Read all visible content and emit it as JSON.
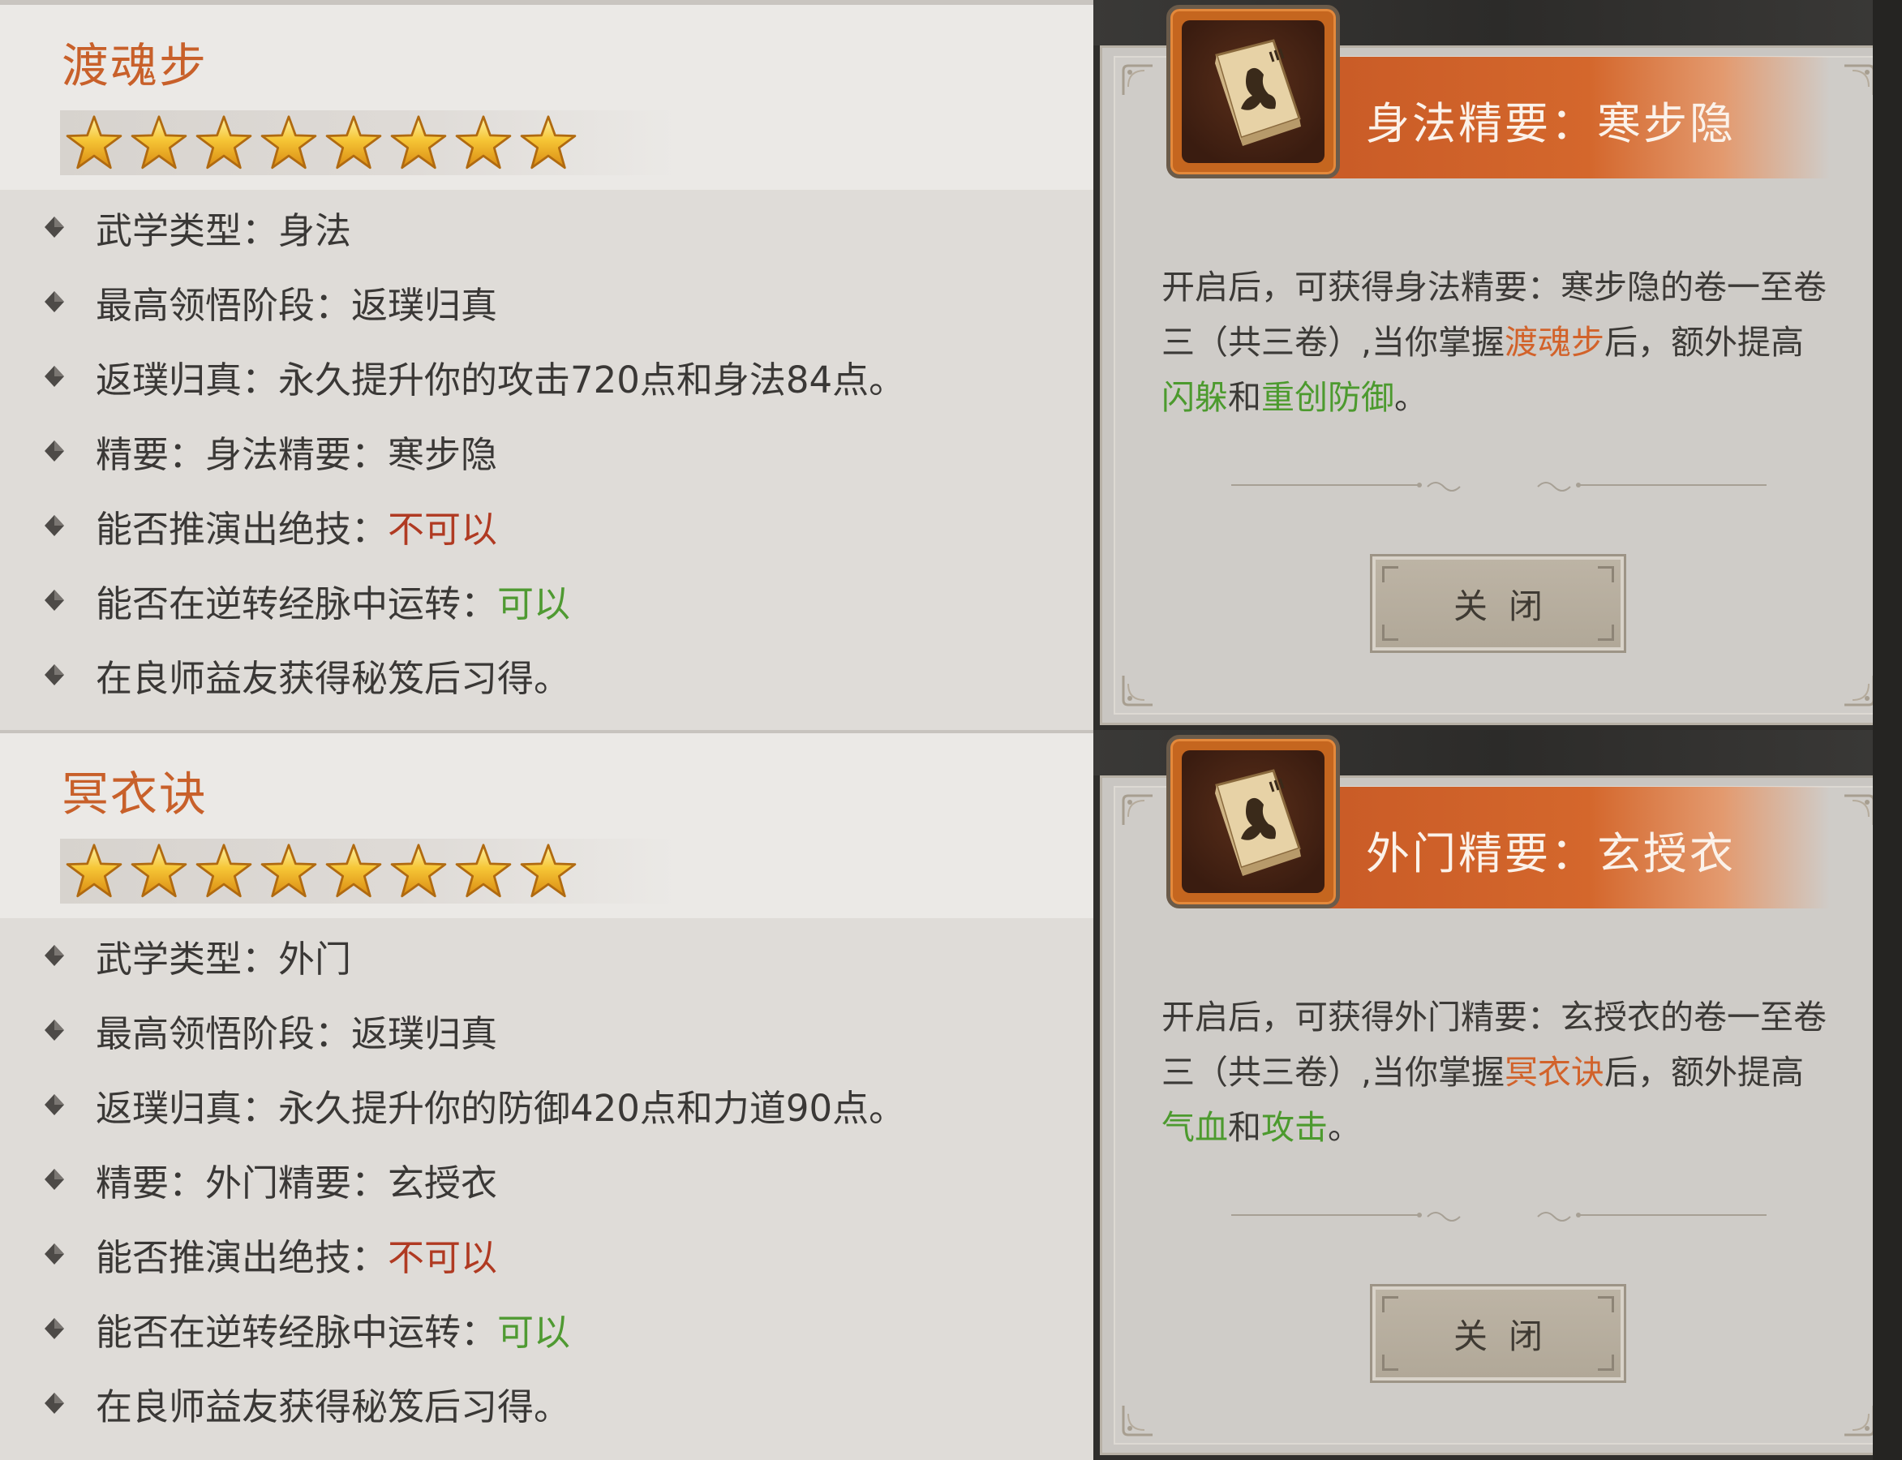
{
  "skills": [
    {
      "name": "渡魂步",
      "stars": 8,
      "attributes": {
        "type": "武学类型：身法",
        "max_stage": "最高领悟阶段：返璞归真",
        "stage_bonus": "返璞归真：永久提升你的攻击720点和身法84点。",
        "essence": "精要：身法精要：寒步隐",
        "deduce_label": "能否推演出绝技：",
        "deduce_value": "不可以",
        "reverse_label": "能否在逆转经脉中运转：",
        "reverse_value": "可以",
        "source": "在良师益友获得秘笈后习得。"
      }
    },
    {
      "name": "冥衣诀",
      "stars": 8,
      "attributes": {
        "type": "武学类型：外门",
        "max_stage": "最高领悟阶段：返璞归真",
        "stage_bonus": "返璞归真：永久提升你的防御420点和力道90点。",
        "essence": "精要：外门精要：玄授衣",
        "deduce_label": "能否推演出绝技：",
        "deduce_value": "不可以",
        "reverse_label": "能否在逆转经脉中运转：",
        "reverse_value": "可以",
        "source": "在良师益友获得秘笈后习得。"
      }
    }
  ],
  "dialogs": [
    {
      "title": "身法精要：寒步隐",
      "item_icon": "martial-manual-icon",
      "desc": {
        "part1": "开启后，可获得身法精要：寒步隐的卷一至卷三（共三卷）,当你掌握",
        "skill": "渡魂步",
        "part2": "后，额外提高",
        "stat1": "闪躲",
        "and": "和",
        "stat2": "重创防御",
        "end": "。"
      },
      "close_label": "关闭"
    },
    {
      "title": "外门精要：玄授衣",
      "item_icon": "martial-manual-icon",
      "desc": {
        "part1": "开启后，可获得外门精要：玄授衣的卷一至卷三（共三卷）,当你掌握",
        "skill": "冥衣诀",
        "part2": "后，额外提高",
        "stat1": "气血",
        "and": "和",
        "stat2": "攻击",
        "end": "。"
      },
      "close_label": "关闭"
    }
  ],
  "colors": {
    "skill_name": "#c8602a",
    "negative": "#b03a22",
    "positive": "#4f9a32",
    "title_band": "#d4672c"
  }
}
